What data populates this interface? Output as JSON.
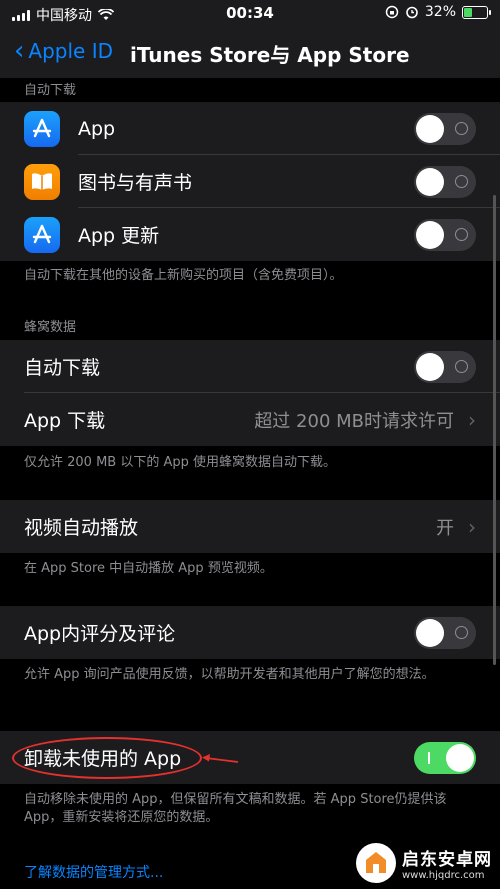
{
  "status_bar": {
    "carrier": "中国移动",
    "time": "00:34",
    "battery_percent": "32%",
    "battery_level": 0.32,
    "icons": [
      "signal-icon",
      "wifi-icon",
      "rotation-lock-icon",
      "alarm-icon",
      "battery-icon"
    ]
  },
  "nav": {
    "back_label": "Apple ID",
    "title": "iTunes Store与 App Store"
  },
  "auto_downloads": {
    "header": "自动下载",
    "items": [
      {
        "label": "App",
        "icon": "app-store-icon",
        "enabled": false
      },
      {
        "label": "图书与有声书",
        "icon": "books-icon",
        "enabled": false
      },
      {
        "label": "App 更新",
        "icon": "app-store-icon",
        "enabled": false
      }
    ],
    "footer": "自动下载在其他的设备上新购买的项目（含免费项目）。"
  },
  "cellular": {
    "header": "蜂窝数据",
    "auto_download_label": "自动下载",
    "auto_download_enabled": false,
    "app_download_label": "App 下载",
    "app_download_value": "超过 200 MB时请求许可",
    "footer": "仅允许 200 MB 以下的 App 使用蜂窝数据自动下载。"
  },
  "video": {
    "label": "视频自动播放",
    "value": "开",
    "footer": "在 App Store 中自动播放 App 预览视频。"
  },
  "ratings": {
    "label": "App内评分及评论",
    "enabled": false,
    "footer": "允许 App 询问产品使用反馈，以帮助开发者和其他用户了解您的想法。"
  },
  "offload": {
    "label": "卸载未使用的 App",
    "enabled": true,
    "footer": "自动移除未使用的 App，但保留所有文稿和数据。若 App Store仍提供该 App，重新安装将还原您的数据。"
  },
  "link": "了解数据的管理方式...",
  "watermark": {
    "name": "启东安卓网",
    "url": "www.hjqdrc.com"
  },
  "colors": {
    "accent": "#0a84ff",
    "toggle_on": "#4cd964",
    "annotation": "#e3312d"
  }
}
